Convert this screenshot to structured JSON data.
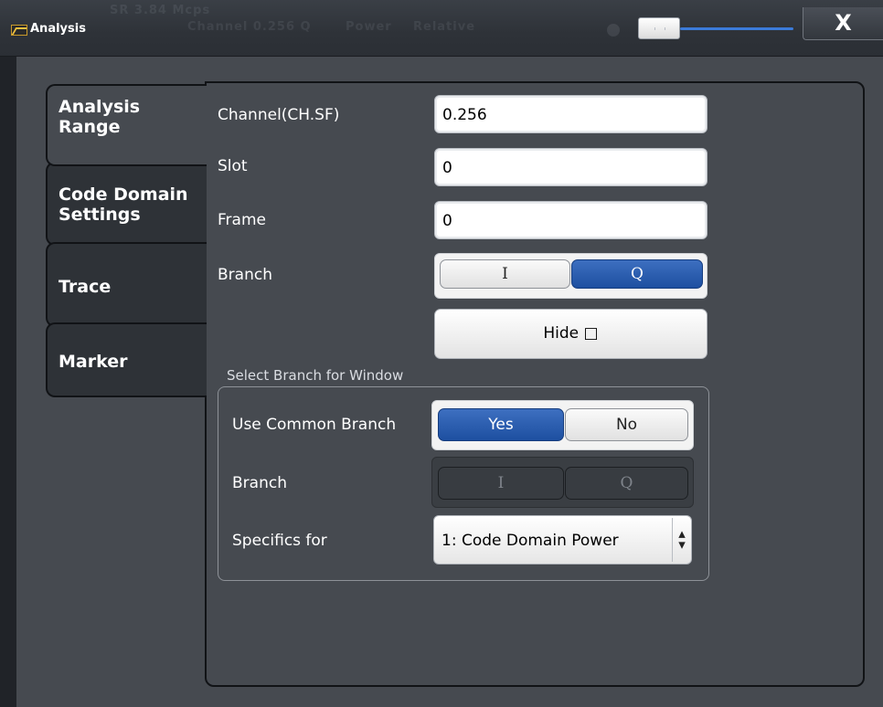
{
  "window": {
    "title": "Analysis",
    "close_label": "X",
    "background_ghost": [
      "SR 3.84 Mcps",
      "Channel 0.256 Q",
      "Power",
      "Relative"
    ]
  },
  "tabs": [
    {
      "label_line1": "Analysis",
      "label_line2": "Range",
      "active": true
    },
    {
      "label_line1": "Code Domain",
      "label_line2": "Settings",
      "active": false
    },
    {
      "label_line1": "Trace",
      "label_line2": "",
      "active": false
    },
    {
      "label_line1": "Marker",
      "label_line2": "",
      "active": false
    }
  ],
  "analysis_range": {
    "channel": {
      "label": "Channel(CH.SF)",
      "value": "0.256"
    },
    "slot": {
      "label": "Slot",
      "value": "0"
    },
    "frame": {
      "label": "Frame",
      "value": "0"
    },
    "branch": {
      "label": "Branch",
      "options": [
        "I",
        "Q"
      ],
      "selected": "Q"
    },
    "hide_button": "Hide □"
  },
  "select_branch_for_window": {
    "title": "Select Branch for Window",
    "use_common_branch": {
      "label": "Use Common Branch",
      "options": [
        "Yes",
        "No"
      ],
      "selected": "Yes"
    },
    "branch": {
      "label": "Branch",
      "options": [
        "I",
        "Q"
      ],
      "enabled": false
    },
    "specifics_for": {
      "label": "Specifics for",
      "value": "1: Code Domain Power"
    }
  },
  "colors": {
    "accent_blue": "#1d4fa0",
    "background": "#464a50",
    "titlebar_slider": "#3b7bd9"
  }
}
